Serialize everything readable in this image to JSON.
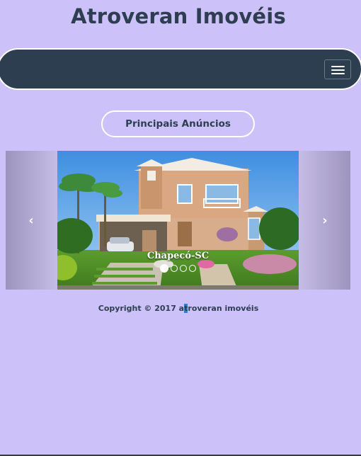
{
  "header": {
    "title": "Atroveran Imovéis"
  },
  "navbar": {
    "toggle_icon": "hamburger-menu-icon",
    "background_color": "#2c3e50"
  },
  "section": {
    "title": "Principais Anúncios"
  },
  "carousel": {
    "caption": "Chapecó-SC",
    "indicator_count": 4,
    "active_index": 0,
    "prev_icon": "chevron-left-icon",
    "next_icon": "chevron-right-icon",
    "prev_glyph": "‹",
    "next_glyph": "›"
  },
  "footer": {
    "copyright_prefix": "Copyright © 2017 a",
    "highlight_char": "t",
    "copyright_suffix": "roveran imovéis"
  },
  "colors": {
    "page_background": "#cdc1f9",
    "accent": "#2c3e50",
    "selection": "#2f7fd6"
  }
}
